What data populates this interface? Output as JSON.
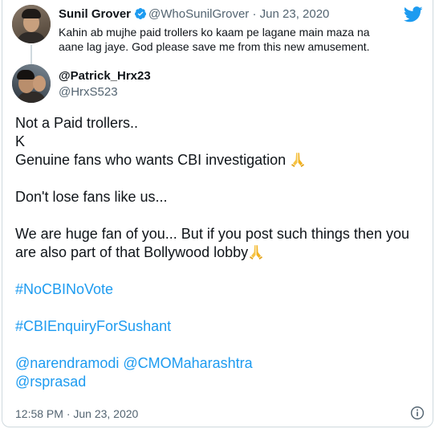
{
  "parent_tweet": {
    "name": "Sunil Grover",
    "handle": "@WhoSunilGrover",
    "separator": "·",
    "date": "Jun 23, 2020",
    "text": "Kahin ab mujhe paid trollers ko kaam pe lagane main maza na aane lag jaye. God please save me from this new amusement."
  },
  "tweet": {
    "name": "@Patrick_Hrx23",
    "handle": "@HrxS523",
    "lines": {
      "l1": "Not a Paid trollers..",
      "l2": "K",
      "l3": "Genuine fans who wants CBI investigation ",
      "l4": "Don't lose fans like us...",
      "l5": "We are huge fan of you... But if you post such things then you are also part of that Bollywood lobby",
      "h1": "#NoCBINoVote",
      "h2": "#CBIEnquiryForSushant",
      "m1": "@narendramodi",
      "m2": "@CMOMaharashtra",
      "m3": "@rsprasad"
    },
    "timestamp": "12:58 PM · Jun 23, 2020"
  },
  "icons": {
    "bird": "twitter-bird-icon",
    "verified": "verified-badge-icon",
    "info": "info-icon",
    "emoji": "folded-hands-emoji"
  },
  "colors": {
    "link": "#1d9bf0",
    "secondary_text": "#536471",
    "border": "#cfd9de"
  }
}
